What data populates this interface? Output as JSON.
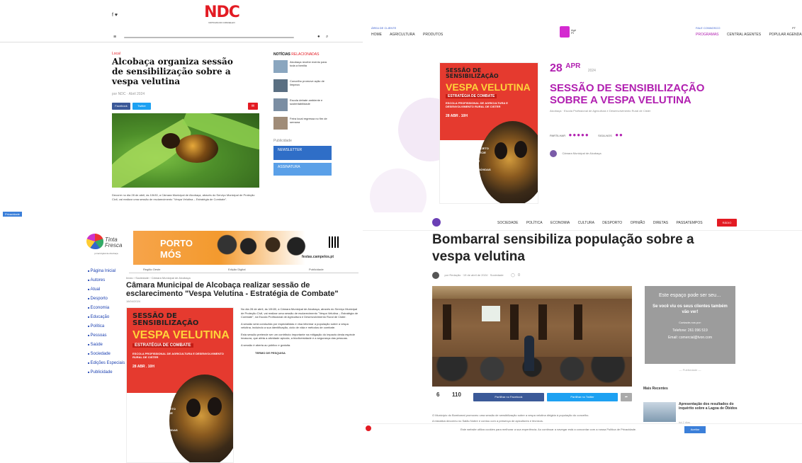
{
  "q1": {
    "logo": "NDC",
    "logo_sub": "NOTICIAS DO CONCELHO",
    "social": "f  ♥",
    "category": "Local",
    "title": "Alcobaça organiza sessão de sensibilização sobre a vespa velutina",
    "author_meta": "por NDC · Abril 2024",
    "btn_facebook": "Facebook",
    "btn_twitter": "Twitter",
    "sidebar_title": "NOTÍCIAS",
    "sidebar_subtitle": "RELACIONADAS",
    "sidebar_items": [
      "Alcobaça recebe evento para toda a família",
      "Concelho promove ação de limpeza",
      "Escola debate ambiente e sustentabilidade",
      "Feira local regressa no fim de semana"
    ],
    "sidebar_label": "Publicidade",
    "widget_1": "NEWSLETTER",
    "widget_2": "ASSINATURA",
    "caption": "Decorre no dia 28 de abril, às 10h30, a Câmara Municipal de Alcobaça, através do Serviço Municipal de Proteção Civil, vai realizar uma sessão de esclarecimento \"Vespa Velutina – Estratégia de Combate\".",
    "badge": "Privacidade"
  },
  "q2": {
    "top_left_link": "ÁREA DE CLIENTE",
    "nav_left": [
      "HOME",
      "AGRICULTURA",
      "PRODUTOS"
    ],
    "top_right_link": "FALE CONNOSCO",
    "lang": "PT",
    "nav_right": [
      "PROGRAMAS",
      "CENTRAL AGENTES",
      "POPULAR AGENDA"
    ],
    "date_day": "28",
    "date_month": "APR",
    "date_year": "2024",
    "title": "SESSÃO DE SENSIBILIZAÇÃO SOBRE A VESPA VELUTINA",
    "meta": "Alcobaça · Escola Profissional de Agricultura e Desenvolvimento Rural de Cister",
    "share_label": "PARTILHAR",
    "follow_label": "SIGA-NOS",
    "author": "Câmara Municipal de Alcobaça"
  },
  "poster": {
    "line1": "SESSÃO DE",
    "line2": "SENSIBILIZAÇÃO",
    "line3": "VESPA VELUTINA",
    "line4": "ESTRATÉGIA DE COMBATE",
    "line5": "ESCOLA PROFISSIONAL DE AGRICULTURA E DESENVOLVIMENTO RURAL DE CISTER",
    "date": "28 ABR . 10H",
    "bullets": [
      "· APRESENTAÇÃO DO PROJETO",
      "· IDENTIFICAÇÃO DA ESPÉCIE",
      "· CICLO DE VIDA",
      "· MÉTODOS DE COMBATE",
      "· PREVENÇÃO",
      "· ESCLARECIMENTO DE DÚVIDAS"
    ]
  },
  "q3": {
    "logo_line1": "Tinta",
    "logo_line2": "Fresca",
    "logo_sub": "jornal digital de Alcobaça",
    "banner_city": "PORTO",
    "banner_city2": "MÓS",
    "banner_site": "festas.campelos.pt",
    "subnav": [
      "Região Oeste",
      "Edição Digital",
      "Publicidade"
    ],
    "menu": [
      "Página Inicial",
      "Autores",
      "Atual",
      "Desporto",
      "Economia",
      "Educação",
      "Política",
      "Pessoas",
      "Saúde",
      "Sociedade",
      "Edições Especiais",
      "Publicidade"
    ],
    "breadcrumb": "Início › Sociedade › Câmara Municipal de Alcobaça",
    "title": "Câmara Municipal de Alcobaça realizar sessão de esclarecimento \"Vespa Velutina - Estratégia de Combate\"",
    "date": "18/04/2024",
    "p1": "No dia 28 de abril, às 10h30, a Câmara Municipal de Alcobaça, através do Serviço Municipal de Proteção Civil, vai realizar uma sessão de esclarecimento \"Vespa Velutina – Estratégia de Combate\", na Escola Profissional de Agricultura e Desenvolvimento Rural de Cister.",
    "p2": "A sessão será conduzida por especialistas e visa informar a população sobre a vespa velutina, incluindo a sua identificação, ciclo de vida e métodos de combate.",
    "p3": "Esta sessão pretende ser um contributo importante na mitigação do impacto desta espécie invasora, que afeta a atividade apícola, a biodiversidade e a segurança das pessoas.",
    "p4": "A sessão é aberta ao público e gratuita.",
    "tag": "TERMO DE PESQUISA"
  },
  "q4": {
    "nav": [
      "SOCIEDADE",
      "POLÍTICA",
      "ECONOMIA",
      "CULTURA",
      "DESPORTO",
      "OPINIÃO",
      "DIRETAS",
      "PASSATEMPOS"
    ],
    "nav_btn": "RÁDIO",
    "title": "Bombarral sensibiliza população sobre a vespa velutina",
    "meta": "por Redação · 19 de abril de 2024 · Sociedade",
    "comments": "0",
    "share_count": "6",
    "view_count": "110",
    "btn_facebook": "Partilhar no Facebook",
    "btn_twitter": "Partilhar no Twitter",
    "ad_line1": "Este espaço pode ser seu…",
    "ad_line2": "Se você viu os seus clientes também vão ver!",
    "ad_line3": "Contacte-nos por:",
    "ad_phone": "Telefone: 261 096 519",
    "ad_email": "Email: comercial@tvon.com",
    "ad_note": "— Publicidade —",
    "related_title": "Mais Recentes",
    "related_item": "Apresentação dos resultados do inquérito sobre a Lagoa de Óbidos",
    "related_meta": "há 2 dias",
    "body_line1": "O Município do Bombarral promoveu uma sessão de sensibilização sobre a vespa velutina dirigida à população do concelho.",
    "body_line2": "A iniciativa decorreu no Salão Nobre e contou com a presença de apicultores e técnicos.",
    "cookie_text": "Este website utiliza cookies para melhorar a sua experiência. Ao continuar a navegar está a concordar com a nossa Política de Privacidade.",
    "cookie_btn": "Aceitar"
  }
}
